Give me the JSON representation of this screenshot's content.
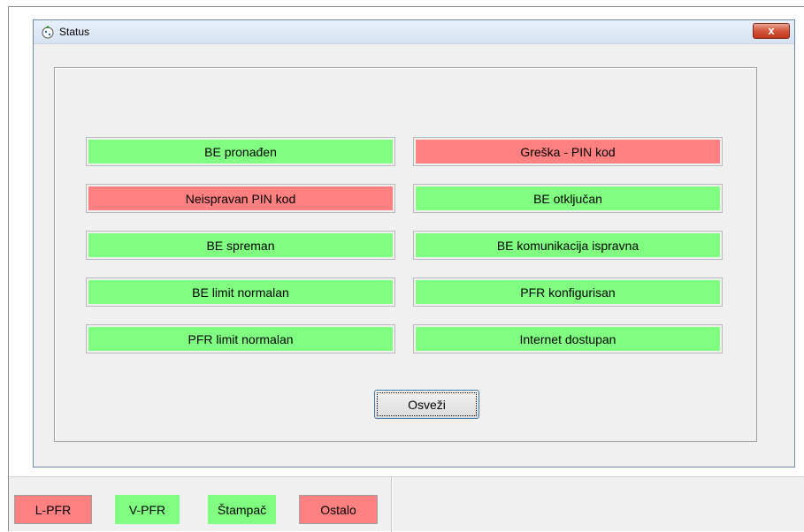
{
  "window": {
    "title": "Status",
    "close_label": "x"
  },
  "status_items": [
    {
      "label": "BE pronađen",
      "status": "ok"
    },
    {
      "label": "Greška - PIN kod",
      "status": "error"
    },
    {
      "label": "Neispravan PIN kod",
      "status": "error"
    },
    {
      "label": "BE otključan",
      "status": "ok"
    },
    {
      "label": "BE spreman",
      "status": "ok"
    },
    {
      "label": "BE komunikacija ispravna",
      "status": "ok"
    },
    {
      "label": "BE limit normalan",
      "status": "ok"
    },
    {
      "label": "PFR konfigurisan",
      "status": "ok"
    },
    {
      "label": "PFR limit normalan",
      "status": "ok"
    },
    {
      "label": "Internet dostupan",
      "status": "ok"
    }
  ],
  "refresh_button": {
    "label": "Osveži"
  },
  "indicators": [
    {
      "label": "L-PFR",
      "status": "error"
    },
    {
      "label": "V-PFR",
      "status": "ok"
    },
    {
      "label": "Štampač",
      "status": "ok"
    },
    {
      "label": "Ostalo",
      "status": "error"
    }
  ],
  "colors": {
    "ok": "#80ff80",
    "error": "#ff8080",
    "window_border": "#6f8aa8",
    "focus_border": "#3d7bad"
  }
}
